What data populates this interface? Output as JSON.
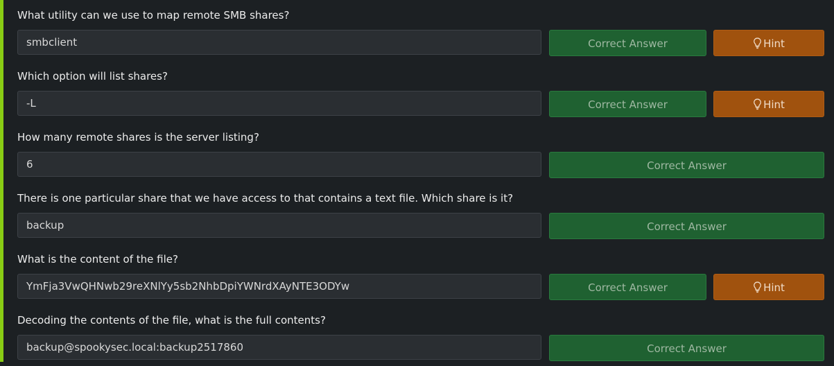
{
  "questions": [
    {
      "prompt": "What utility can we use to map remote SMB shares?",
      "answer": "smbclient",
      "correct_label": "Correct Answer",
      "hint_label": "Hint",
      "has_hint": true
    },
    {
      "prompt": "Which option will list shares?",
      "answer": "-L",
      "correct_label": "Correct Answer",
      "hint_label": "Hint",
      "has_hint": true
    },
    {
      "prompt": "How many remote shares is the server listing?",
      "answer": "6",
      "correct_label": "Correct Answer",
      "has_hint": false
    },
    {
      "prompt": "There is one particular share that we have access to that contains a text file. Which share is it?",
      "answer": "backup",
      "correct_label": "Correct Answer",
      "has_hint": false
    },
    {
      "prompt": "What is the content of the file?",
      "answer": "YmFja3VwQHNwb29reXNlYy5sb2NhbDpiYWNrdXAyNTE3ODYw",
      "correct_label": "Correct Answer",
      "hint_label": "Hint",
      "has_hint": true
    },
    {
      "prompt": "Decoding the contents of the file, what is the full contents?",
      "answer": "backup@spookysec.local:backup2517860",
      "correct_label": "Correct Answer",
      "has_hint": false
    }
  ],
  "colors": {
    "accent": "#88cc14",
    "correct_button": "#1f6131",
    "hint_button": "#a0520e",
    "background": "#1c2023"
  },
  "icons": {
    "hint": "lightbulb-icon"
  }
}
